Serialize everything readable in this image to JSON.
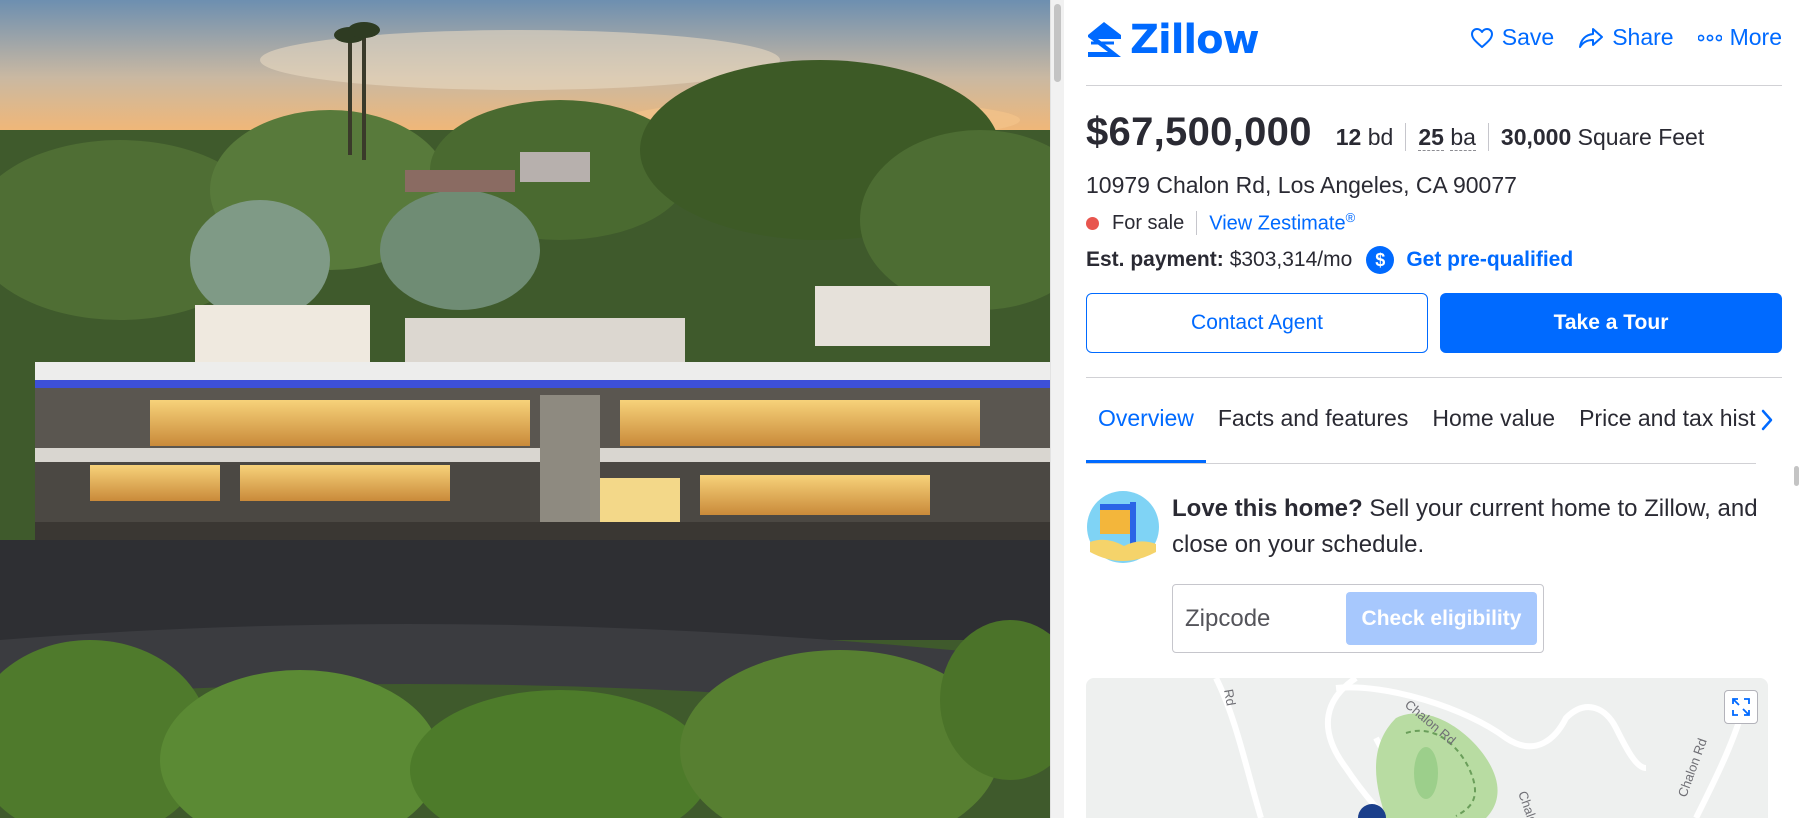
{
  "header": {
    "logo_text": "Zillow",
    "actions": [
      {
        "label": "Save",
        "icon": "heart-icon"
      },
      {
        "label": "Share",
        "icon": "share-arrow-icon"
      },
      {
        "label": "More",
        "icon": "more-dots-icon"
      }
    ]
  },
  "listing": {
    "price": "$67,500,000",
    "beds_num": "12",
    "beds_unit": "bd",
    "baths_num": "25",
    "baths_unit": "ba",
    "sqft_num": "30,000",
    "sqft_unit": "Square Feet",
    "address": "10979 Chalon Rd, Los Angeles, CA 90077",
    "status": "For sale",
    "status_color": "#e8554e",
    "zestimate_link": "View Zestimate",
    "zestimate_mark": "®",
    "payment_label": "Est. payment:",
    "payment_value": "$303,314/mo",
    "payment_badge": "$",
    "prequal_link": "Get pre-qualified"
  },
  "cta": {
    "contact": "Contact Agent",
    "tour": "Take a Tour"
  },
  "tabs": [
    {
      "label": "Overview",
      "active": true
    },
    {
      "label": "Facts and features",
      "active": false
    },
    {
      "label": "Home value",
      "active": false
    },
    {
      "label": "Price and tax history",
      "active": false
    }
  ],
  "promo": {
    "bold": "Love this home?",
    "text": " Sell your current home to Zillow, and close on your schedule.",
    "zip_placeholder": "Zipcode",
    "check_button": "Check eligibility"
  },
  "map": {
    "street_labels": [
      "Chalon Rd",
      "Chalon Rd",
      "Rd"
    ]
  },
  "colors": {
    "brand": "#006aff",
    "text": "#2a2a33",
    "button_disabled": "#a7c8fd"
  }
}
